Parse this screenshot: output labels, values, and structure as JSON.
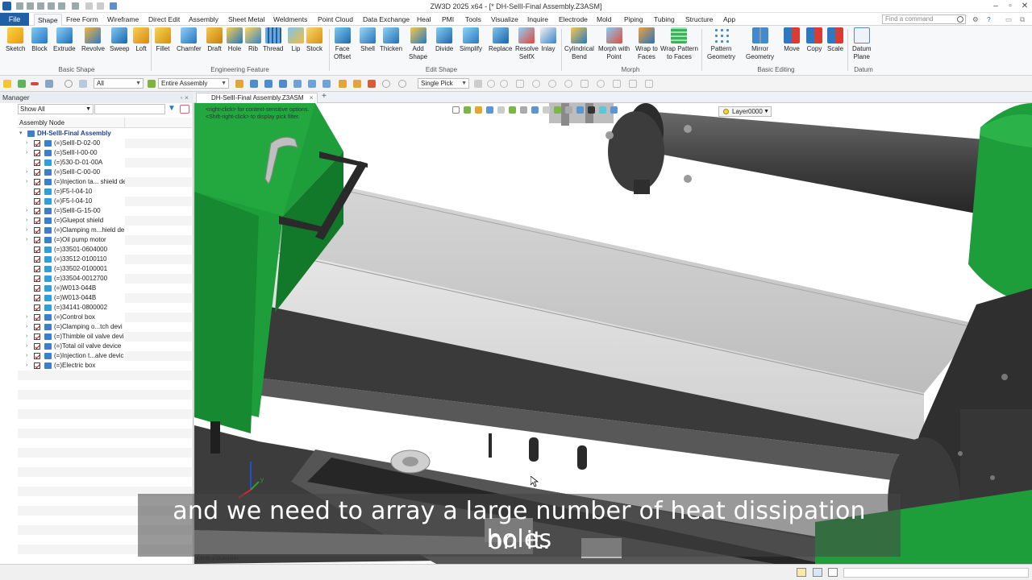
{
  "window": {
    "title": "ZW3D 2025 x64 - [* DH-SellI-Final Assembly.Z3ASM]"
  },
  "menubar": {
    "file": "File",
    "tabs": [
      "Shape",
      "Free Form",
      "Wireframe",
      "Direct Edit",
      "Assembly",
      "Sheet Metal",
      "Weldments",
      "Point Cloud",
      "Data Exchange",
      "Heal",
      "PMI",
      "Tools",
      "Visualize",
      "Inquire",
      "Electrode",
      "Mold",
      "Piping",
      "Tubing",
      "Structure",
      "App"
    ],
    "active_tab": "Shape",
    "find_placeholder": "Find a command"
  },
  "ribbon": {
    "basic_shape": {
      "label": "Basic Shape",
      "buttons": [
        "Sketch",
        "Block",
        "Extrude",
        "Revolve",
        "Sweep",
        "Loft"
      ]
    },
    "engineering_feature": {
      "label": "Engineering Feature",
      "buttons": [
        "Fillet",
        "Chamfer",
        "Draft",
        "Hole",
        "Rib",
        "Thread",
        "Lip",
        "Stock"
      ]
    },
    "edit_shape": {
      "label": "Edit Shape",
      "buttons": [
        "Face\nOffset",
        "Shell",
        "Thicken",
        "Add\nShape",
        "Divide",
        "Simplify",
        "Replace",
        "Resolve\nSelfX",
        "Inlay"
      ]
    },
    "morph": {
      "label": "Morph",
      "buttons": [
        "Cylindrical\nBend",
        "Morph with\nPoint",
        "Wrap to\nFaces",
        "Wrap Pattern\nto Faces"
      ]
    },
    "basic_editing": {
      "label": "Basic Editing",
      "buttons": [
        "Pattern\nGeometry",
        "Mirror\nGeometry",
        "Move",
        "Copy",
        "Scale"
      ]
    },
    "datum": {
      "label": "Datum",
      "buttons": [
        "Datum\nPlane"
      ]
    }
  },
  "toolbar2": {
    "filter_value": "All",
    "scope_value": "Entire Assembly",
    "pick_value": "Single Pick"
  },
  "manager": {
    "title": "Manager",
    "show_filter": "Show All",
    "column_header": "Assembly Node",
    "root": "DH-SellI-Final Assembly",
    "items": [
      "(=)SellI-D-02-00",
      "(=)SellI-I-00-00",
      "(=)530-D-01-00A",
      "(=)SellI-C-00-00",
      "(=)Injection ta... shield de",
      "(=)F5-I-04-10",
      "(=)F5-I-04-10",
      "(=)SellI-G-15-00",
      "(=)Gluepot shield",
      "(=)Clamping m...hield de",
      "(=)Oil pump motor",
      "(=)33501-0604000",
      "(=)33512-0100110",
      "(=)33502-0100001",
      "(=)33504-0012700",
      "(=)W013-044B",
      "(=)W013-044B",
      "(=)34141-0800002",
      "(=)Control box",
      "(=)Clamping o...tch devi",
      "(=)Thimble oil valve devi",
      "(=)Total oil valve device",
      "(=)Injection t...alve devic",
      "(=)Electric box"
    ]
  },
  "document": {
    "tab_label": "DH-SellI-Final Assembly.Z3ASM"
  },
  "viewport": {
    "hint_text": "<right-click> for context-sensitive options.\n<Shift-right-click> to display pick filter.",
    "layer": "Layer0000",
    "measure": "769.753mm"
  },
  "subtitle": {
    "line1": "and we need to array a large number of heat dissipation holes",
    "line2": "on it."
  },
  "colors": {
    "accent": "#1f5fa6",
    "machine_green": "#1e9e3a",
    "rail_gray": "#c9c9c9"
  }
}
